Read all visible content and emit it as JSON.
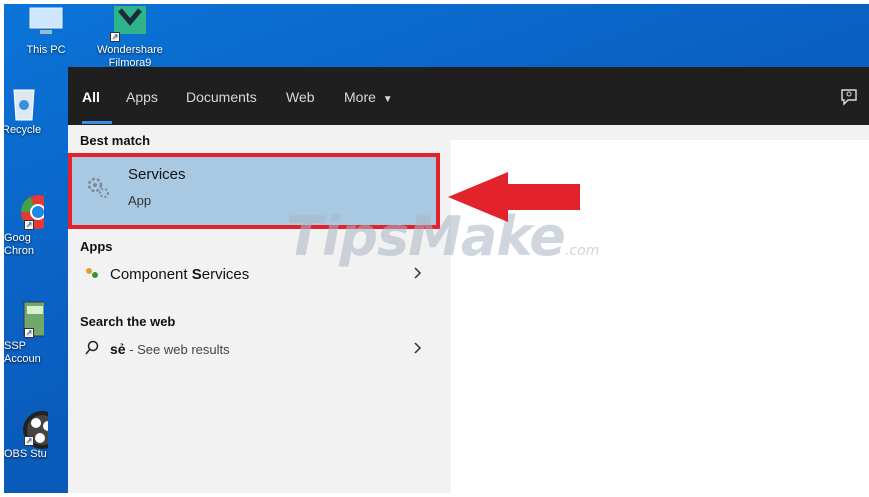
{
  "desktop": {
    "icons": [
      {
        "label": "This PC",
        "icon": "computer-icon"
      },
      {
        "label": "Wondershare\nFilmora9",
        "icon": "filmora-icon"
      },
      {
        "label": "Recycle",
        "icon": "recycle-bin-icon"
      },
      {
        "label": "Goog\nChron",
        "icon": "chrome-icon"
      },
      {
        "label": "SSP\nAccoun",
        "icon": "ssp-accounting-icon"
      },
      {
        "label": "OBS Stu",
        "icon": "obs-studio-icon"
      }
    ]
  },
  "search": {
    "tabs": [
      "All",
      "Apps",
      "Documents",
      "Web",
      "More"
    ],
    "more_caret": "▼",
    "feedback_icon": "feedback-icon"
  },
  "results": {
    "best_match_header": "Best match",
    "best_match": {
      "title": "Services",
      "subtitle": "App",
      "icon": "services-gears-icon"
    },
    "apps_header": "Apps",
    "apps": [
      {
        "pre": "Component ",
        "bold": "S",
        "post": "ervices",
        "icon": "component-services-icon"
      }
    ],
    "web_header": "Search the web",
    "web": {
      "query": "sẻ",
      "suffix": " - See web results",
      "icon": "search-icon"
    }
  },
  "overlay": {
    "watermark": "TipsMake",
    "watermark_suffix": ".com",
    "highlight_color": "#e3232c",
    "arrow_color": "#e3232c"
  }
}
